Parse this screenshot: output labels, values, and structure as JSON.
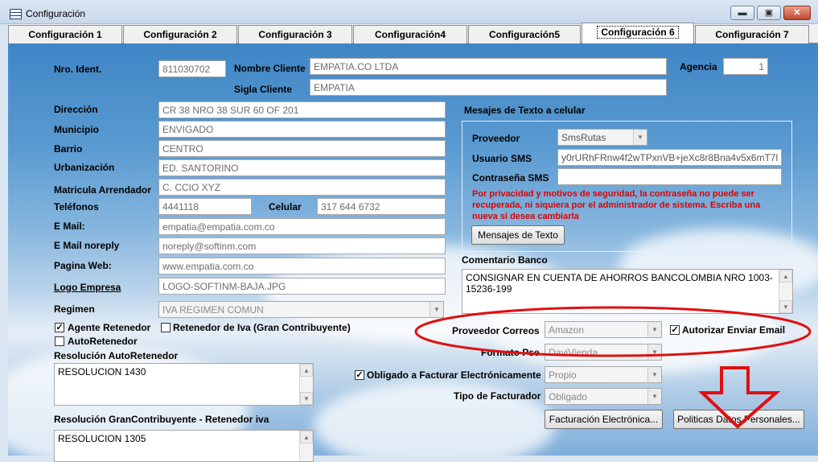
{
  "window": {
    "title": "Configuración",
    "minimize": "▬",
    "maximize": "▣",
    "close": "✕"
  },
  "tabs": [
    "Configuración 1",
    "Configuración 2",
    "Configuración 3",
    "Configuración4",
    "Configuración5",
    "Configuración 6",
    "Configuración 7"
  ],
  "active_tab": "Configuración 6",
  "labels": {
    "nro_ident": "Nro. Ident.",
    "nombre_cliente": "Nombre Cliente",
    "agencia": "Agencia",
    "sigla_cliente": "Sigla Cliente",
    "direccion": "Dirección",
    "municipio": "Municipio",
    "barrio": "Barrio",
    "urbanizacion": "Urbanización",
    "matricula": "Matricula Arrendador",
    "telefonos": "Teléfonos",
    "celular": "Celular",
    "email": "E Mail:",
    "email_noreply": "E Mail noreply",
    "pagina_web": "Pagina Web:",
    "logo_empresa": "Logo Empresa",
    "regimen": "Regimen",
    "res_autoretenedor": "Resolución AutoRetenedor",
    "res_gran": "Resolución GranContribuyente  - Retenedor iva",
    "sms_group": "Mesajes de Texto a celular",
    "proveedor": "Proveedor",
    "usuario_sms": "Usuario SMS",
    "contrasena_sms": "Contraseña SMS",
    "comentario_banco": "Comentario Banco",
    "proveedor_correos": "Proveedor Correos",
    "formato_pse": "Formato Pse",
    "tipo_facturador": "Tipo de Facturador"
  },
  "values": {
    "nro_ident": "811030702",
    "nombre_cliente": "EMPATIA.CO LTDA",
    "agencia": "1",
    "sigla_cliente": "EMPATIA",
    "direccion": "CR 38 NRO 38 SUR 60 OF 201",
    "municipio": "ENVIGADO",
    "barrio": "CENTRO",
    "urbanizacion": "ED. SANTORINO",
    "matricula": "C. CCIO XYZ",
    "telefonos": "4441118",
    "celular": "317 644 6732",
    "email": "empatia@empatia.com.co",
    "email_noreply": "noreply@softinm.com",
    "pagina_web": "www.empatia.com.co",
    "logo_empresa": "LOGO-SOFTINM-BAJA.JPG",
    "regimen": "IVA REGIMEN COMUN",
    "res_autoretenedor": "RESOLUCION 1430",
    "res_gran": "RESOLUCION  1305",
    "proveedor_sms": "SmsRutas",
    "usuario_sms": "y0rURhFRnw4f2wTPxnVB+jeXc8r8Bna4v5x6mT7l",
    "contrasena_sms": "",
    "comentario_banco": "CONSIGNAR EN CUENTA DE AHORROS BANCOLOMBIA NRO 1003-15236-199",
    "proveedor_correos": "Amazon",
    "formato_pse": "DaviVienda",
    "facturar_valor": "Propio",
    "tipo_facturador": "Obligado"
  },
  "checkboxes": {
    "agente_retenedor": {
      "label": "Agente Retenedor",
      "checked": true
    },
    "retenedor_iva": {
      "label": "Retenedor de Iva (Gran Contribuyente)",
      "checked": false
    },
    "autoretenedor": {
      "label": "AutoRetenedor",
      "checked": false
    },
    "autorizar_email": {
      "label": "Autorizar Enviar Email",
      "checked": true
    },
    "obligado_facturar": {
      "label": "Obligado a Facturar Electrónicamente",
      "checked": true
    }
  },
  "warning": "Por privacidad y motivos de seguridad, la contraseña no puede ser recuperada, ni siquiera por el administrador de sistema. Escriba una nueva si desea cambiarla",
  "buttons": {
    "mensajes": "Mensajes de Texto",
    "facturacion": "Facturación Electrónica...",
    "politicas": "Politicas Datos Personales..."
  },
  "annotation_color": "#e01010"
}
